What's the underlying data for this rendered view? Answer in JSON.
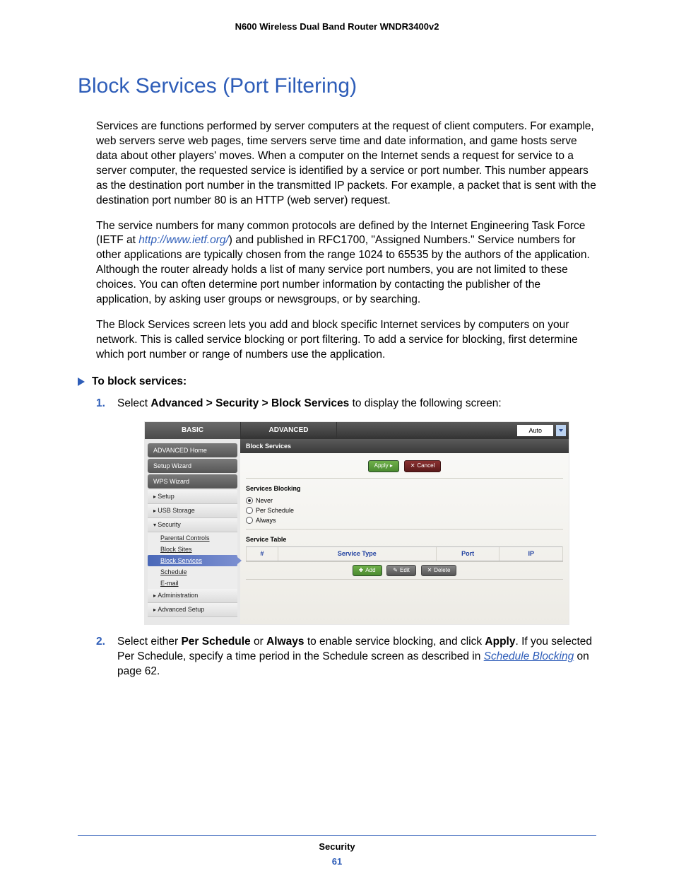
{
  "doc_header": "N600 Wireless Dual Band Router WNDR3400v2",
  "title": "Block Services (Port Filtering)",
  "p1": "Services are functions performed by server computers at the request of client computers. For example, web servers serve web pages, time servers serve time and date information, and game hosts serve data about other players' moves. When a computer on the Internet sends a request for service to a server computer, the requested service is identified by a service or port number. This number appears as the destination port number in the transmitted IP packets. For example, a packet that is sent with the destination port number 80 is an HTTP (web server) request.",
  "p2a": "The service numbers for many common protocols are defined by the Internet Engineering Task Force (IETF at ",
  "p2link": "http://www.ietf.org/",
  "p2b": ") and published in RFC1700, \"Assigned Numbers.\" Service numbers for other applications are typically chosen from the range 1024 to 65535 by the authors of the application. Although the router already holds a list of many service port numbers, you are not limited to these choices. You can often determine port number information by contacting the publisher of the application, by asking user groups or newsgroups, or by searching.",
  "p3": "The Block Services screen lets you add and block specific Internet services by computers on your network. This is called service blocking or port filtering. To add a service for blocking, first determine which port number or range of numbers use the application.",
  "proc_heading": "To block services:",
  "step1a": "Select ",
  "step1b": "Advanced > Security > Block Services",
  "step1c": " to display the following screen:",
  "step2a": "Select either ",
  "step2b": "Per Schedule",
  "step2c": " or ",
  "step2d": "Always",
  "step2e": " to enable service blocking, and click ",
  "step2f": "Apply",
  "step2g": ". If you selected Per Schedule, specify a time period in the Schedule screen as described in ",
  "step2h": "Schedule Blocking",
  "step2i": " on page 62.",
  "footer_label": "Security",
  "footer_page": "61",
  "ui": {
    "tab_basic": "BASIC",
    "tab_advanced": "ADVANCED",
    "auto": "Auto",
    "sidebar": {
      "home": "ADVANCED Home",
      "wizard": "Setup Wizard",
      "wps": "WPS Wizard",
      "setup": "Setup",
      "usb": "USB Storage",
      "security": "Security",
      "parental": "Parental Controls",
      "block_sites": "Block Sites",
      "block_services": "Block Services",
      "schedule": "Schedule",
      "email": "E-mail",
      "admin": "Administration",
      "adv_setup": "Advanced Setup"
    },
    "panel_title": "Block Services",
    "apply": "Apply ▸",
    "cancel_x": "✕",
    "cancel": "Cancel",
    "services_blocking": "Services Blocking",
    "never": "Never",
    "per_schedule": "Per Schedule",
    "always": "Always",
    "service_table": "Service Table",
    "col_num": "#",
    "col_type": "Service Type",
    "col_port": "Port",
    "col_ip": "IP",
    "add": "Add",
    "edit": "Edit",
    "delete": "Delete"
  }
}
